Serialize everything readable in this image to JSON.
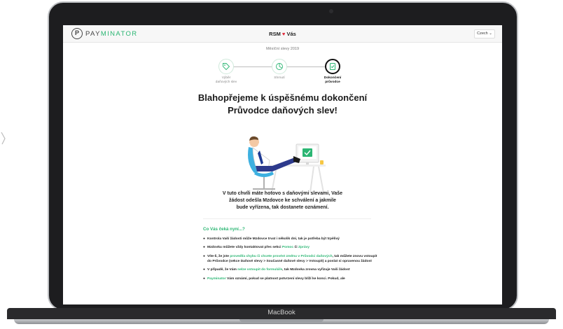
{
  "header": {
    "logo_mark": "P",
    "logo_pay": "PAY",
    "logo_minator": "MINATOR",
    "company_left": "RSM",
    "company_heart": "♥",
    "company_right": "Vás",
    "language": "Czech ⌄"
  },
  "period": "Měsíční slevy 2019",
  "steps": [
    {
      "label_line1": "Výběr",
      "label_line2": "daňových slev",
      "icon": "tag-icon"
    },
    {
      "label_line1": "Shrnutí",
      "label_line2": "",
      "icon": "summary-icon"
    },
    {
      "label_line1": "Dokončení",
      "label_line2": "průvodce",
      "icon": "document-check-icon"
    }
  ],
  "headline_line1": "Blahopřejeme k úspěšnému dokončení",
  "headline_line2": "Průvodce daňových slev!",
  "message_line1": "V tuto chvíli máte hotovo s daňovými slevami, Vaše",
  "message_line2": "žádost odešla Mzdovce ke schválení a jakmile",
  "message_line3": "bude vyřízena, tak dostanete oznámení.",
  "section_title": "Co Vás čeká nyní...?",
  "bullets": {
    "b1": "Kontrola Vaší žádosti může Mzdovce trvat i několik dní, tak je potřeba být trpělivý",
    "b2_pre": "Mzdovku můžete vždy kontaktovat přes sekci ",
    "b2_link1": "Pomoc",
    "b2_mid": " či ",
    "b2_link2": "Zprávy",
    "b3_pre": "Víte-li, že jste ",
    "b3_link": "provedl/a chybu či chcete provést změnu v Průvodci daňových",
    "b3_post": ", tak můžete znovu vstoupit do Průvodce (sekce Daňové slevy > Současné daňové slevy > Vstoupit) a poslat si opravenou žádost",
    "b4_pre": "V případě, že Vám ",
    "b4_link": "nelze vstoupit do formuláře",
    "b4_post": ", tak Mzdovka zrovna vyřizuje Vaši žádost",
    "b5_link": "Payminator",
    "b5_post": " Vám oznámí, pokud se platnost potvrzení slevy blíží ke konci. Pokud, ale"
  },
  "bullet_symbol": "●",
  "device_brand": "MacBook",
  "colors": {
    "accent": "#2bb673",
    "heart": "#e0283a",
    "text": "#222222"
  }
}
